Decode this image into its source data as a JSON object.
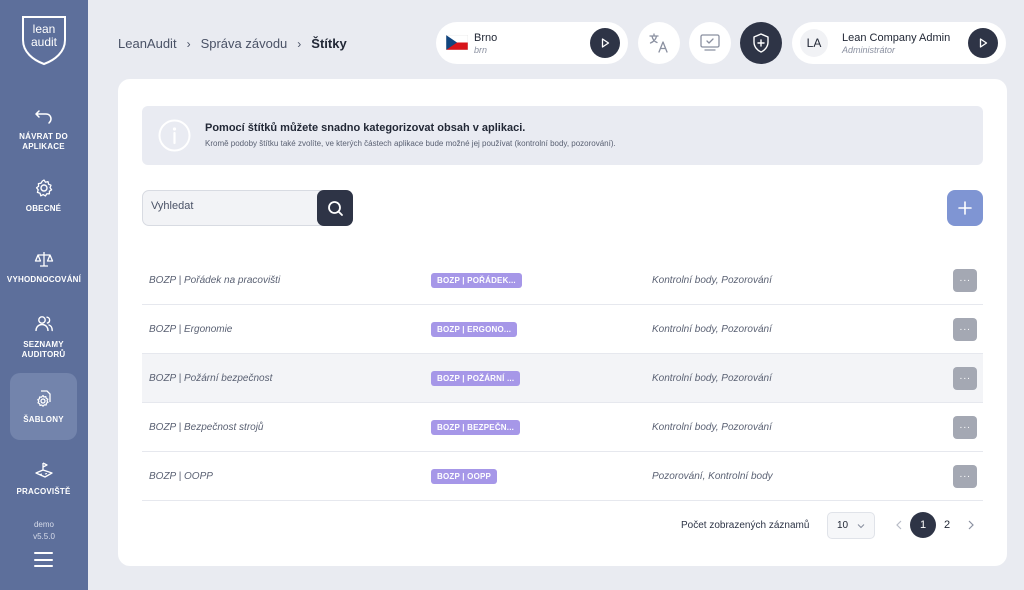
{
  "sidebar": {
    "logo_line1": "lean",
    "logo_line2": "audit",
    "items": [
      {
        "label": "Návrat do aplikace",
        "icon": "undo-icon"
      },
      {
        "label": "Obecné",
        "icon": "gear-icon"
      },
      {
        "label": "Vyhodnocování",
        "icon": "scale-icon"
      },
      {
        "label": "Seznamy auditorů",
        "icon": "users-icon"
      },
      {
        "label": "Šablony",
        "icon": "template-gear-icon"
      },
      {
        "label": "Pracoviště",
        "icon": "workplace-icon"
      }
    ],
    "env": "demo",
    "version": "v5.5.0"
  },
  "breadcrumb": {
    "items": [
      "LeanAudit",
      "Správa závodu",
      "Štítky"
    ]
  },
  "header": {
    "location_name": "Brno",
    "location_code": "brn",
    "user_initials": "LA",
    "user_name": "Lean Company Admin",
    "user_role": "Administrátor"
  },
  "info": {
    "title": "Pomocí štítků můžete snadno kategorizovat obsah v aplikaci.",
    "text": "Kromě podoby štítku také zvolíte, ve kterých částech aplikace bude možné jej používat (kontrolní body, pozorování)."
  },
  "search": {
    "placeholder": "Vyhledat"
  },
  "table": {
    "rows": [
      {
        "name": "BOZP | Pořádek na pracovišti",
        "tag": "BOZP | POŘÁDEK...",
        "usage": "Kontrolní body, Pozorování"
      },
      {
        "name": "BOZP | Ergonomie",
        "tag": "BOZP | ERGONO...",
        "usage": "Kontrolní body, Pozorování"
      },
      {
        "name": "BOZP | Požární bezpečnost",
        "tag": "BOZP | POŽÁRNÍ ...",
        "usage": "Kontrolní body, Pozorování"
      },
      {
        "name": "BOZP | Bezpečnost strojů",
        "tag": "BOZP | BEZPEČN...",
        "usage": "Kontrolní body, Pozorování"
      },
      {
        "name": "BOZP | OOPP",
        "tag": "BOZP | OOPP",
        "usage": "Pozorování, Kontrolní body"
      }
    ],
    "more_label": "···"
  },
  "pagination": {
    "label": "Počet zobrazených záznamů",
    "page_size": "10",
    "pages": [
      "1",
      "2"
    ],
    "current_page": "1"
  },
  "colors": {
    "sidebar": "#5d6f9b",
    "dark": "#2e3446",
    "accent": "#7f95d3",
    "tag": "#a697e8"
  }
}
